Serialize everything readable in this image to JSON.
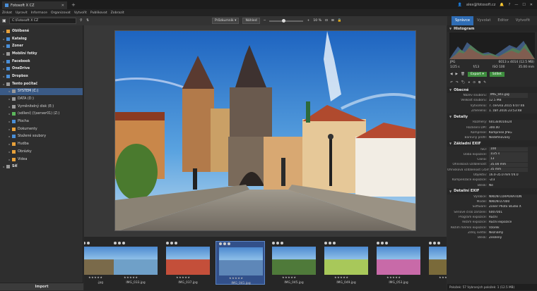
{
  "app": {
    "tab_title": "Fotosoft X CZ",
    "new_tab": "+",
    "account": "alex@fotosoft.cz"
  },
  "menu": [
    "Získat",
    "Upravit",
    "Informace",
    "Organizovat",
    "Vytvořit",
    "Publikovat",
    "Zobrazit"
  ],
  "toolbar": {
    "path": "C:\\Fotosoft X CZ",
    "browser_label": "Průzkumník",
    "preview_label": "Náhled",
    "zoom": "10 %"
  },
  "tree": [
    {
      "label": "Oblíbené",
      "top": true,
      "icon": "ic-orange"
    },
    {
      "label": "Katalog",
      "top": true,
      "icon": "ic-blue"
    },
    {
      "label": "Zoner",
      "top": true,
      "icon": "ic-blue"
    },
    {
      "label": "Mobilní fotky",
      "top": true,
      "icon": "ic-gray"
    },
    {
      "label": "Facebook",
      "top": true,
      "icon": "ic-blue"
    },
    {
      "label": "OneDrive",
      "top": true,
      "icon": "ic-blue"
    },
    {
      "label": "Dropbox",
      "top": true,
      "icon": "ic-blue"
    },
    {
      "label": "Tento počítač",
      "top": true,
      "icon": "ic-gray"
    },
    {
      "label": "SYSTEM (C:)",
      "top": false,
      "icon": "ic-gray",
      "sel": true
    },
    {
      "label": "DATA (D:)",
      "top": false,
      "icon": "ic-gray"
    },
    {
      "label": "Vyměnitelný disk (E:)",
      "top": false,
      "icon": "ic-gray"
    },
    {
      "label": "(sdílení) (\\\\server01) (Z:)",
      "top": false,
      "icon": "ic-green"
    },
    {
      "label": "Plocha",
      "top": false,
      "icon": "ic-blue"
    },
    {
      "label": "Dokumenty",
      "top": false,
      "icon": "ic-orange"
    },
    {
      "label": "Stažené soubory",
      "top": false,
      "icon": "ic-blue"
    },
    {
      "label": "Hudba",
      "top": false,
      "icon": "ic-orange"
    },
    {
      "label": "Obrázky",
      "top": false,
      "icon": "ic-orange"
    },
    {
      "label": "Videa",
      "top": false,
      "icon": "ic-orange"
    },
    {
      "label": "Síť",
      "top": true,
      "icon": "ic-gray"
    }
  ],
  "import_button": "Import",
  "filmstrip": [
    {
      "name": ".jpg",
      "bg": "#7a6a4a"
    },
    {
      "name": "IMG_033.jpg",
      "bg": "#6fa0c8"
    },
    {
      "name": "IMG_037.jpg",
      "bg": "#c44f3a"
    },
    {
      "name": "IMG_041.jpg",
      "bg": "#5e87b8",
      "sel": true
    },
    {
      "name": "IMG_045.jpg",
      "bg": "#4f7a3a"
    },
    {
      "name": "IMG_049.jpg",
      "bg": "#a8c85a"
    },
    {
      "name": "IMG_053.jpg",
      "bg": "#c86aa8"
    },
    {
      "name": "IMG_",
      "bg": "#7a6a3a"
    }
  ],
  "right_tabs": [
    "Správce",
    "Vyvolat",
    "Editor",
    "Vytvořit"
  ],
  "histogram": {
    "title": "Histogram",
    "format": "JPG",
    "resolution": "6013 x 4014 (12.5 MB)",
    "shutter": "1/25 s",
    "aperture": "f/13",
    "iso": "ISO 100",
    "focal": "35.00 mm"
  },
  "actions": {
    "export": "Export",
    "share": "Sdílet"
  },
  "sections": {
    "general": {
      "title": "Obecné",
      "rows": [
        {
          "k": "Název souboru:",
          "v": "IMG_041.jpg",
          "box": true
        },
        {
          "k": "Velikost souboru:",
          "v": "12.5 MB"
        },
        {
          "k": "Vytvořeno:",
          "v": "7. června 2015 6:07:46"
        },
        {
          "k": "Změněno:",
          "v": "1. září 2016 23:53:48"
        }
      ]
    },
    "details": {
      "title": "Detaily",
      "rows": [
        {
          "k": "Rozměry:",
          "v": "6013x4014x24"
        },
        {
          "k": "Rozlišení DPI:",
          "v": "300.00"
        },
        {
          "k": "Komprese:",
          "v": "Komprese JPEG"
        },
        {
          "k": "Barevný profil:",
          "v": "Nedefinovaný"
        }
      ]
    },
    "exif": {
      "title": "Základní EXIF",
      "rows": [
        {
          "k": "ISO:",
          "v": "100",
          "box": true
        },
        {
          "k": "Doba expozice:",
          "v": "1/25 s",
          "box": true
        },
        {
          "k": "Clona:",
          "v": "13",
          "box": true
        },
        {
          "k": "Ohnisková vzdálenost:",
          "v": "35.00 mm",
          "box": true
        },
        {
          "k": "Ohnisková vzdálenost (35mm):",
          "v": "35 mm",
          "box": true
        },
        {
          "k": "Objektiv:",
          "v": "16.0-35.0 mm f/4.0"
        },
        {
          "k": "Kompenzace expozice:",
          "v": "-2/3"
        },
        {
          "k": "Blesk:",
          "v": "Ne"
        }
      ]
    },
    "detexif": {
      "title": "Detailní EXIF",
      "rows": [
        {
          "k": "Výrobce:",
          "v": "NIKON CORPORATION"
        },
        {
          "k": "Model:",
          "v": "NIKON D7000"
        },
        {
          "k": "Software:",
          "v": "Zoner Photo Studio X"
        },
        {
          "k": "Sériové číslo zařízení:",
          "v": "6007001"
        },
        {
          "k": "Program expozice:",
          "v": "Ruční"
        },
        {
          "k": "Režim expozice:",
          "v": "Ruční expozice"
        },
        {
          "k": "Režim měření expozice:",
          "v": "Vzorek"
        },
        {
          "k": "Zdroj světla:",
          "v": "Neznámý"
        },
        {
          "k": "Blesk:",
          "v": "Zesílený"
        }
      ]
    }
  },
  "status": "Položek: 57   Vybraných položek: 1 (12.5 MB)"
}
